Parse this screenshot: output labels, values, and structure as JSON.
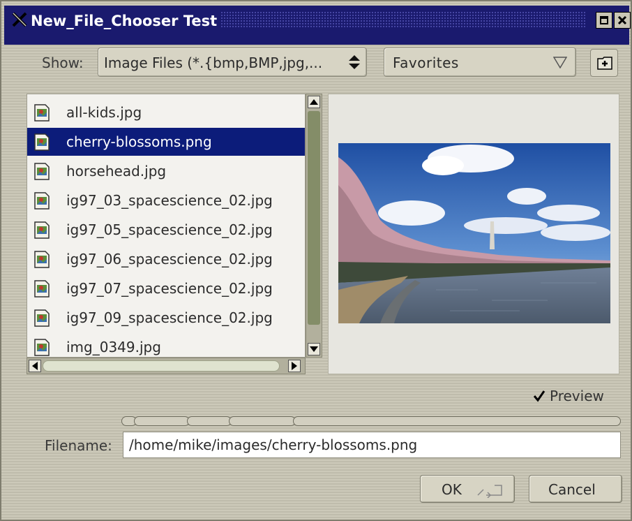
{
  "window": {
    "title": "New_File_Chooser Test",
    "title_icon": "x-app-icon",
    "controls": [
      "maximize-icon",
      "close-icon"
    ]
  },
  "filter": {
    "label": "Show:",
    "selected": "Image Files (*.{bmp,BMP,jpg,..."
  },
  "favorites": {
    "selected": "Favorites"
  },
  "new_folder_icon": "new-folder-icon",
  "files": [
    {
      "name": "all-kids.jpg",
      "selected": false
    },
    {
      "name": "cherry-blossoms.png",
      "selected": true
    },
    {
      "name": "horsehead.jpg",
      "selected": false
    },
    {
      "name": "ig97_03_spacescience_02.jpg",
      "selected": false
    },
    {
      "name": "ig97_05_spacescience_02.jpg",
      "selected": false
    },
    {
      "name": "ig97_06_spacescience_02.jpg",
      "selected": false
    },
    {
      "name": "ig97_07_spacescience_02.jpg",
      "selected": false
    },
    {
      "name": "ig97_09_spacescience_02.jpg",
      "selected": false
    },
    {
      "name": "img_0349.jpg",
      "selected": false
    }
  ],
  "preview": {
    "checkbox_label": "Preview",
    "checked": true
  },
  "filename": {
    "label": "Filename:",
    "value": "/home/mike/images/cherry-blossoms.png"
  },
  "buttons": {
    "ok": "OK",
    "cancel": "Cancel"
  },
  "colors": {
    "titlebar": "#1a1a6e",
    "selection": "#0c1c7a",
    "background": "#c9c6b5"
  }
}
